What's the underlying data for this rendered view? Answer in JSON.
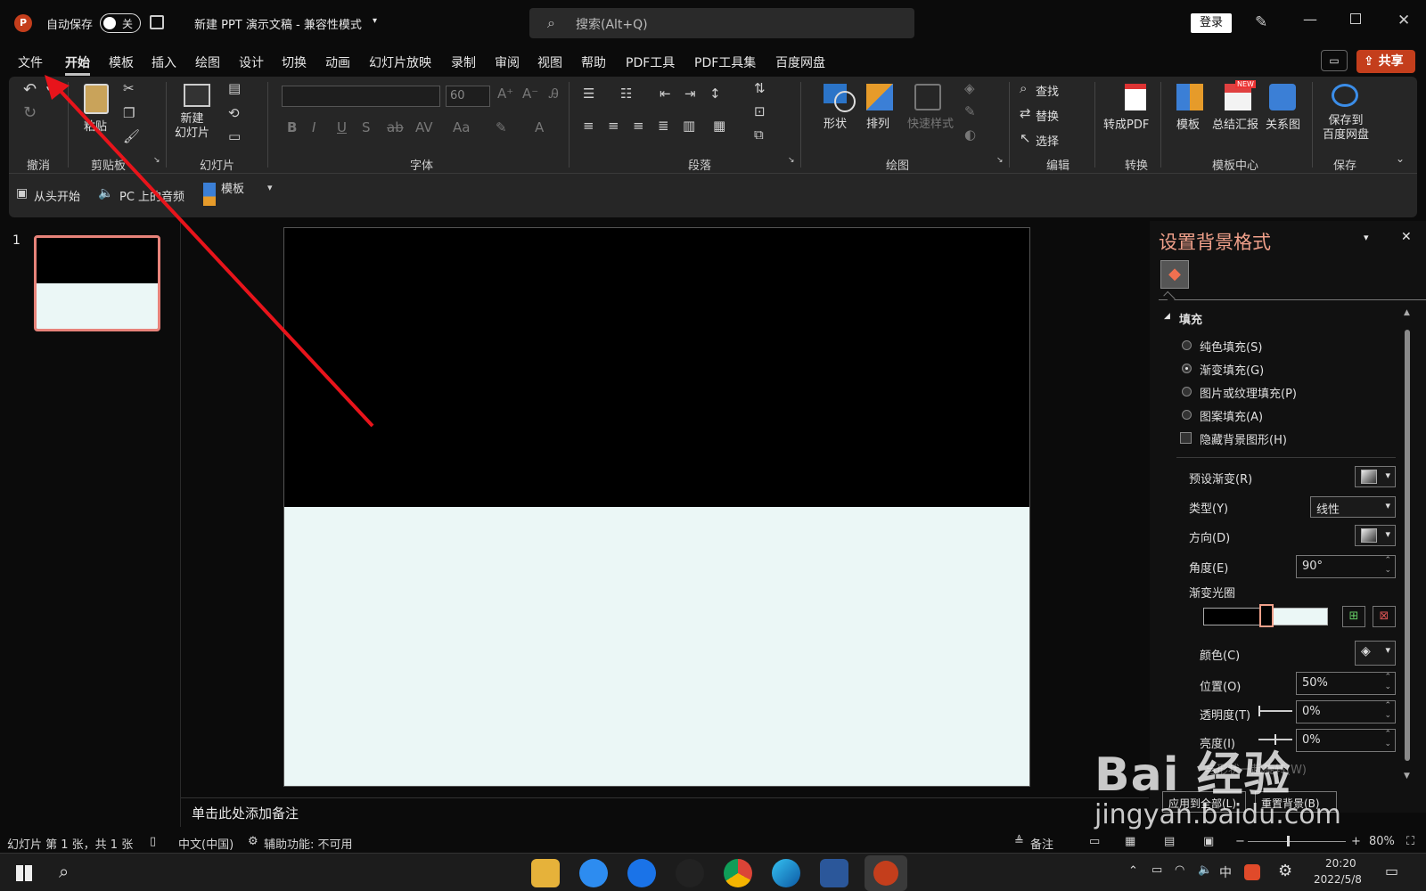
{
  "titlebar": {
    "autosave_label": "自动保存",
    "autosave_state": "关",
    "doc_title": "新建 PPT 演示文稿 - 兼容性模式",
    "search_placeholder": "搜索(Alt+Q)",
    "login_label": "登录"
  },
  "menubar": {
    "tabs": [
      "文件",
      "开始",
      "模板",
      "插入",
      "绘图",
      "设计",
      "切换",
      "动画",
      "幻灯片放映",
      "录制",
      "审阅",
      "视图",
      "帮助",
      "PDF工具",
      "PDF工具集",
      "百度网盘"
    ],
    "active_tab": "开始",
    "share_label": "共享"
  },
  "ribbon": {
    "groups": [
      "撤消",
      "剪贴板",
      "幻灯片",
      "字体",
      "段落",
      "绘图",
      "编辑",
      "转换",
      "模板中心",
      "保存"
    ],
    "paste_label": "粘贴",
    "new_slide_label": "新建\n幻灯片",
    "font_size": "60",
    "shape_label": "形状",
    "arrange_label": "排列",
    "quick_style_label": "快速样式",
    "find_label": "查找",
    "replace_label": "替换",
    "select_label": "选择",
    "to_pdf_label": "转成PDF",
    "template_label": "模板",
    "summary_label": "总结汇报",
    "relation_label": "关系图",
    "save_baidu_label": "保存到\n百度网盘",
    "new_badge": "NEW"
  },
  "qat": {
    "from_start": "从头开始",
    "pc_audio": "PC 上的音频",
    "template": "模板"
  },
  "thumbnails": {
    "slide_number": "1"
  },
  "notes": {
    "placeholder": "单击此处添加备注"
  },
  "panel": {
    "title": "设置背景格式",
    "section": "填充",
    "fill_options": [
      "纯色填充(S)",
      "渐变填充(G)",
      "图片或纹理填充(P)",
      "图案填充(A)"
    ],
    "selected_fill": 1,
    "hide_bg": "隐藏背景图形(H)",
    "preset_label": "预设渐变(R)",
    "type_label": "类型(Y)",
    "type_value": "线性",
    "direction_label": "方向(D)",
    "angle_label": "角度(E)",
    "angle_value": "90°",
    "stops_label": "渐变光圈",
    "color_label": "颜色(C)",
    "position_label": "位置(O)",
    "position_value": "50%",
    "transparency_label": "透明度(T)",
    "transparency_value": "0%",
    "brightness_label": "亮度(I)",
    "brightness_value": "0%",
    "rotate_label": "与形状一起旋转(W)",
    "apply_all": "应用到全部(L)",
    "reset_bg": "重置背景(B)"
  },
  "statusbar": {
    "slide_info": "幻灯片 第 1 张，共 1 张",
    "language": "中文(中国)",
    "accessibility": "辅助功能: 不可用",
    "notes": "备注",
    "zoom": "80%"
  },
  "taskbar": {
    "ime": "中",
    "time": "20:20",
    "date": "2022/5/8"
  },
  "watermark": {
    "brand": "Bai 经验",
    "url": "jingyan.baidu.com"
  },
  "colors": {
    "accent": "#c43e1c",
    "slide_top": "#000000",
    "slide_bottom": "#ebf7f6",
    "annotation_arrow": "#e8141b",
    "panel_title": "#f0a08a"
  }
}
